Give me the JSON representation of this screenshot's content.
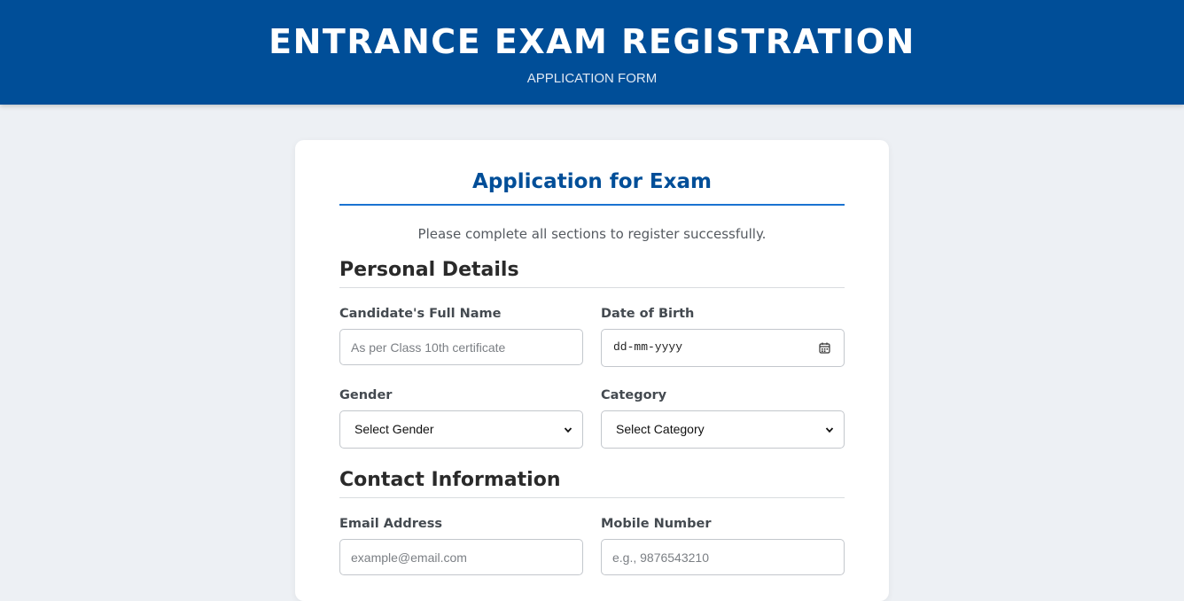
{
  "header": {
    "title": "ENTRANCE EXAM REGISTRATION",
    "subtitle": "APPLICATION FORM",
    "background_color": "#004e98"
  },
  "form": {
    "title": "Application for Exam",
    "intro": "Please complete all sections to register successfully.",
    "accent_color": "#1a73d1",
    "sections": {
      "personal": {
        "title": "Personal Details",
        "full_name": {
          "label": "Candidate's Full Name",
          "placeholder": "As per Class 10th certificate",
          "value": ""
        },
        "dob": {
          "label": "Date of Birth",
          "placeholder": "dd-mm-yyyy",
          "icon": "calendar-icon"
        },
        "gender": {
          "label": "Gender",
          "selected": "Select Gender",
          "icon": "chevron-down-icon"
        },
        "category": {
          "label": "Category",
          "selected": "Select Category",
          "icon": "chevron-down-icon"
        }
      },
      "contact": {
        "title": "Contact Information",
        "email": {
          "label": "Email Address",
          "placeholder": "example@email.com",
          "value": ""
        },
        "mobile": {
          "label": "Mobile Number",
          "placeholder": "e.g., 9876543210",
          "value": ""
        }
      }
    }
  }
}
